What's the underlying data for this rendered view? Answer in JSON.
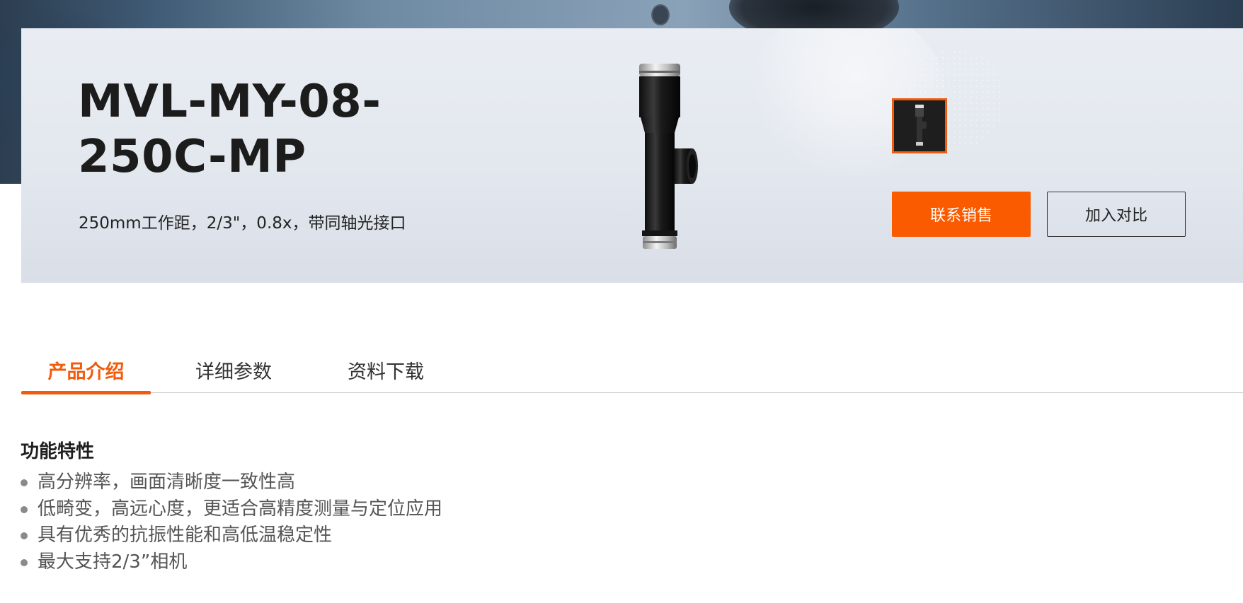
{
  "product": {
    "title": "MVL-MY-08-250C-MP",
    "subtitle": "250mm工作距，2/3\"，0.8x，带同轴光接口"
  },
  "actions": {
    "contact_label": "联系销售",
    "compare_label": "加入对比"
  },
  "tabs": [
    {
      "label": "产品介绍",
      "active": true
    },
    {
      "label": "详细参数",
      "active": false
    },
    {
      "label": "资料下载",
      "active": false
    }
  ],
  "features": {
    "heading": "功能特性",
    "items": [
      "高分辨率，画面清晰度一致性高",
      "低畸变，高远心度，更适合高精度测量与定位应用",
      "具有优秀的抗振性能和高低温稳定性",
      "最大支持2/3”相机"
    ]
  },
  "colors": {
    "accent": "#fa5a00",
    "active_tab": "#f25a0c"
  },
  "icons": {
    "product_image": "telecentric-lens-image",
    "thumbnail": "lens-thumbnail"
  }
}
